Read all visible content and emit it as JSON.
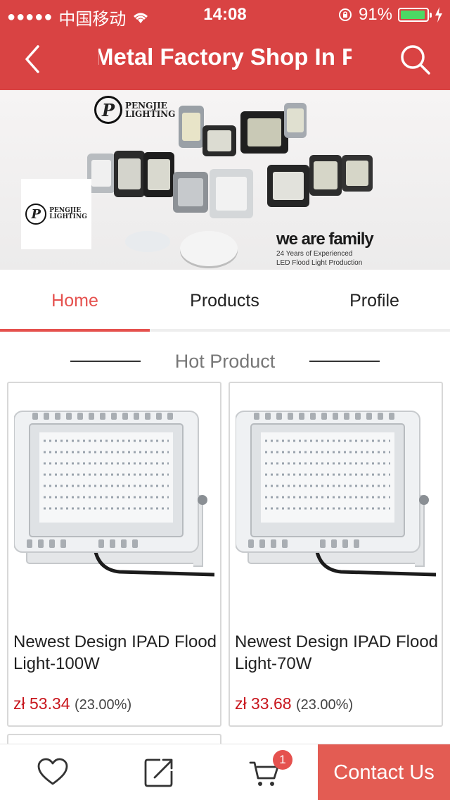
{
  "status_bar": {
    "carrier": "中国移动",
    "time": "14:08",
    "battery": "91%",
    "battery_level": 0.91
  },
  "header": {
    "title": "Metal Factory Shop In Poland"
  },
  "banner": {
    "brand_name_line1": "PENGJIE",
    "brand_name_line2": "LIGHTING",
    "brand_letter": "P",
    "tagline": "we are family",
    "subtitle_line1": "24 Years of Experienced",
    "subtitle_line2": "LED Flood Light Production"
  },
  "tabs": [
    {
      "label": "Home",
      "active": true
    },
    {
      "label": "Products",
      "active": false
    },
    {
      "label": "Profile",
      "active": false
    }
  ],
  "section": {
    "title": "Hot Product"
  },
  "products": [
    {
      "name": "Newest Design IPAD Flood Light-100W",
      "price": "zł 53.34",
      "discount": "(23.00%)"
    },
    {
      "name": "Newest Design IPAD Flood Light-70W",
      "price": "zł 33.68",
      "discount": "(23.00%)"
    }
  ],
  "bottom_bar": {
    "cart_count": "1",
    "contact_label": "Contact Us"
  },
  "colors": {
    "brand_red": "#d94343",
    "accent": "#e5514e",
    "price_red": "#c8161d"
  }
}
